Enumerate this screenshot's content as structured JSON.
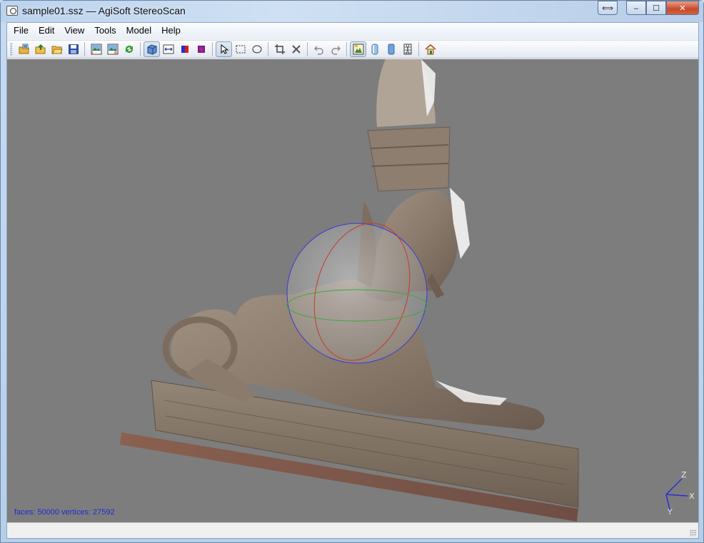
{
  "window": {
    "title": "sample01.ssz — AgiSoft StereoScan",
    "buttons": {
      "restore_extra": "⟺",
      "minimize": "‒",
      "maximize": "☐",
      "close": "✕"
    }
  },
  "menu": [
    "File",
    "Edit",
    "View",
    "Tools",
    "Model",
    "Help"
  ],
  "toolbar": {
    "groups": [
      [
        "open-images-icon",
        "open-project-icon",
        "open-folder-icon",
        "save-icon"
      ],
      [
        "image-left-icon",
        "image-right-icon",
        "refresh-icon"
      ],
      [
        "solid-view-icon",
        "resize-icon",
        "red-blue-icon",
        "purple-square-icon"
      ],
      [
        "pointer-icon",
        "rect-select-icon",
        "ellipse-select-icon"
      ],
      [
        "crop-icon",
        "delete-icon"
      ],
      [
        "undo-icon",
        "redo-icon"
      ],
      [
        "texture-view-icon",
        "shaded-view-icon",
        "flat-view-icon",
        "wireframe-view-icon"
      ],
      [
        "home-icon"
      ]
    ],
    "pressed": [
      "solid-view-icon",
      "pointer-icon",
      "texture-view-icon"
    ]
  },
  "viewport": {
    "stats": "faces: 50000 vertices: 27592",
    "axes": {
      "z": "Z",
      "x": "X",
      "y": "Y"
    },
    "background": "#7d7d7d"
  },
  "status": {
    "text": ""
  }
}
